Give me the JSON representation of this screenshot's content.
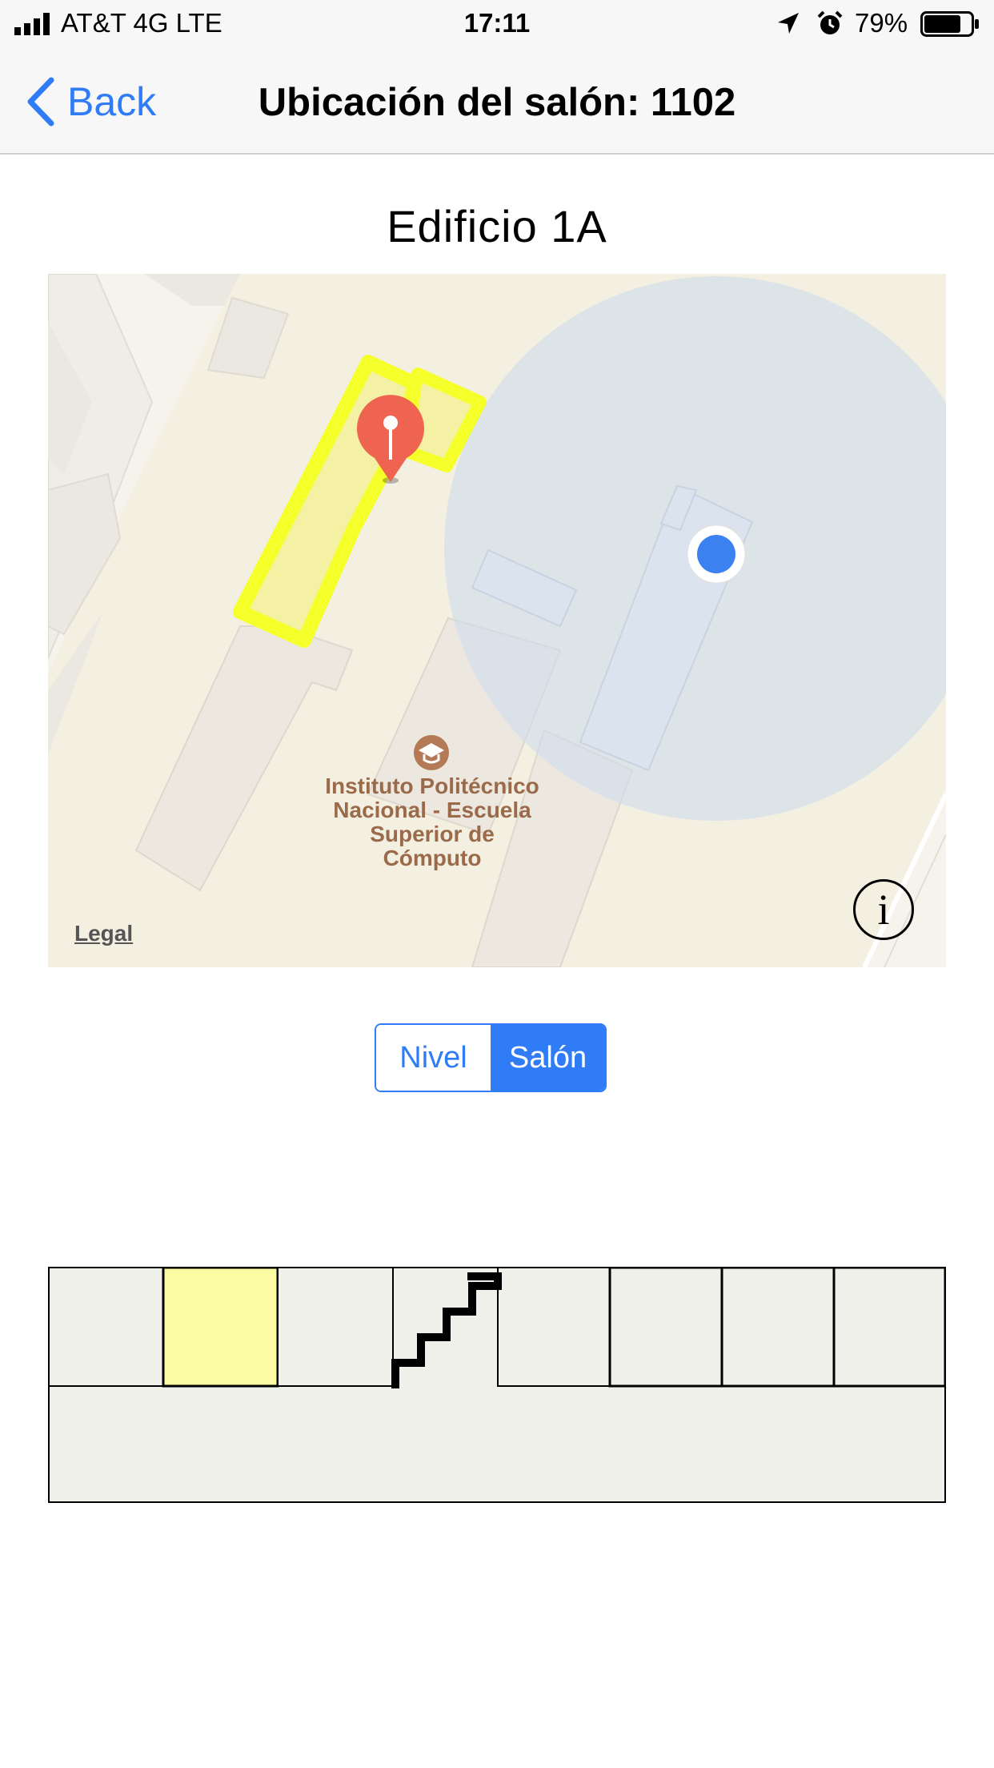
{
  "status_bar": {
    "carrier": "AT&T 4G  LTE",
    "time": "17:11",
    "battery": "79%",
    "battery_level": 0.79
  },
  "nav": {
    "back_label": "Back",
    "title": "Ubicación del salón: 1102"
  },
  "building_title": "Edificio 1A",
  "map": {
    "poi_name": "Instituto Politécnico Nacional - Escuela Superior de Cómputo",
    "poi_icon": "graduation-cap-icon",
    "legal_label": "Legal",
    "info_label": "i",
    "pin_color": "#ef6450",
    "user_location_color": "#3b82f0",
    "highlight_color": "#f5ff2a"
  },
  "segmented_control": {
    "options": [
      "Nivel",
      "Salón"
    ],
    "selected": "Salón"
  },
  "floor_plan": {
    "highlighted_room_color": "#fbfba3",
    "room_color": "#f0f0eb"
  }
}
